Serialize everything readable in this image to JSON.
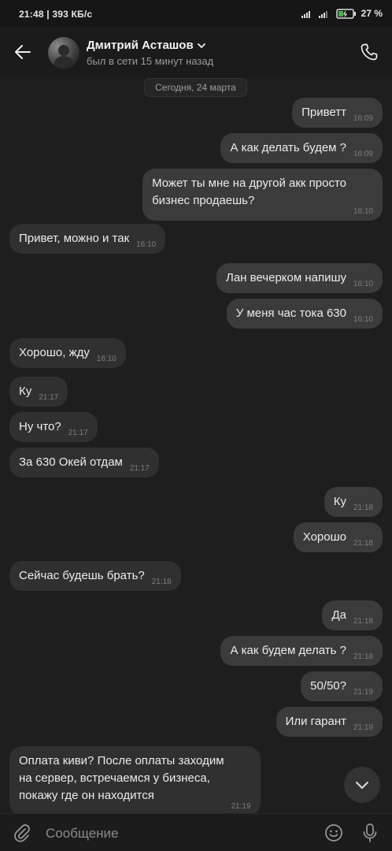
{
  "status_bar": {
    "time_speed": "21:48 | 393 КБ/с",
    "battery": "27 %"
  },
  "header": {
    "contact_name": "Дмитрий Асташов",
    "contact_status": "был в сети 15 минут назад"
  },
  "date_separator": "Сегодня, 24 марта",
  "messages": [
    {
      "dir": "out",
      "text": "Приветт",
      "time": "16:09"
    },
    {
      "dir": "out",
      "text": "А как делать будем ?",
      "time": "16:09"
    },
    {
      "dir": "out",
      "text": "Может ты мне на другой акк просто\nбизнес продаешь?",
      "time": "16:10"
    },
    {
      "dir": "in",
      "text": "Привет, можно и так",
      "time": "16:10"
    },
    {
      "dir": "out",
      "text": "Лан вечерком напишу",
      "time": "16:10"
    },
    {
      "dir": "out",
      "text": "У меня час тока 630",
      "time": "16:10"
    },
    {
      "dir": "in",
      "text": "Хорошо, жду",
      "time": "16:10"
    },
    {
      "dir": "in",
      "text": "Ку",
      "time": "21:17"
    },
    {
      "dir": "in",
      "text": "Ну что?",
      "time": "21:17"
    },
    {
      "dir": "in",
      "text": "За 630 Окей отдам",
      "time": "21:17"
    },
    {
      "dir": "out",
      "text": "Ку",
      "time": "21:18"
    },
    {
      "dir": "out",
      "text": "Хорошо",
      "time": "21:18"
    },
    {
      "dir": "in",
      "text": "Сейчас будешь брать?",
      "time": "21:18"
    },
    {
      "dir": "out",
      "text": "Да",
      "time": "21:18"
    },
    {
      "dir": "out",
      "text": "А как будем делать ?",
      "time": "21:18"
    },
    {
      "dir": "out",
      "text": "50/50?",
      "time": "21:19"
    },
    {
      "dir": "out",
      "text": "Или гарант",
      "time": "21:19"
    },
    {
      "dir": "in",
      "text": "Оплата киви? После оплаты заходим\nна сервер, встречаемся у бизнеса,\nпокажу где он находится",
      "time": "21:19"
    }
  ],
  "composer": {
    "placeholder": "Сообщение"
  }
}
